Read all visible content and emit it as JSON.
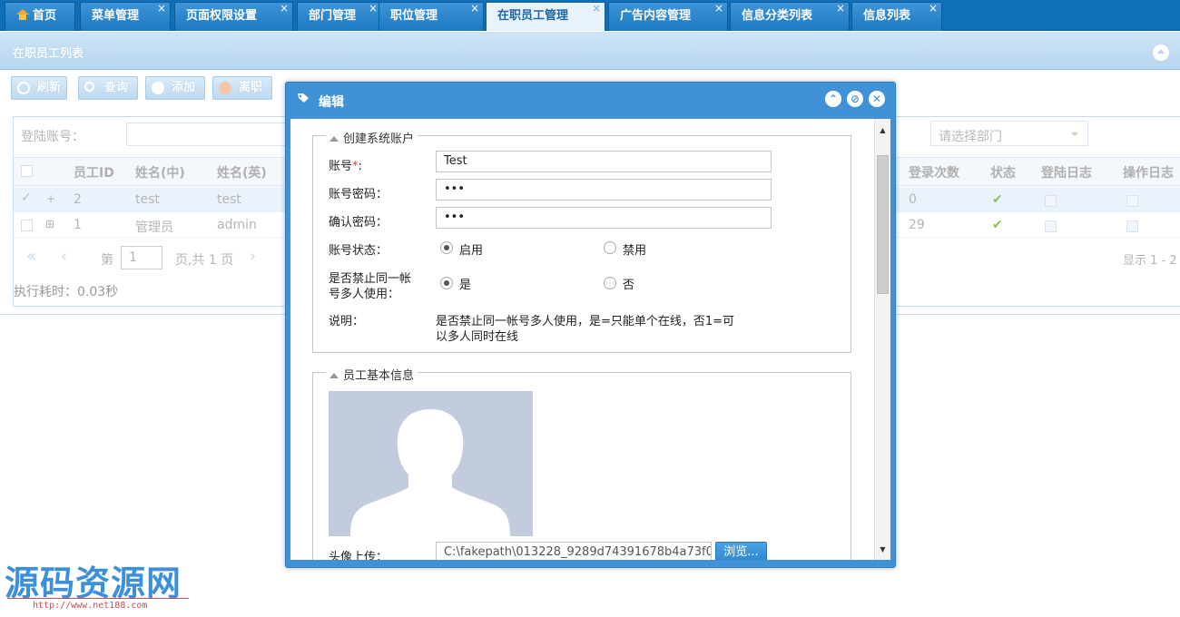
{
  "tabs": [
    {
      "label": "首页",
      "closable": false
    },
    {
      "label": "菜单管理",
      "closable": true
    },
    {
      "label": "页面权限设置",
      "closable": true
    },
    {
      "label": "部门管理",
      "closable": true
    },
    {
      "label": "职位管理",
      "closable": true
    },
    {
      "label": "在职员工管理",
      "closable": true,
      "active": true
    },
    {
      "label": "广告内容管理",
      "closable": true
    },
    {
      "label": "信息分类列表",
      "closable": true
    },
    {
      "label": "信息列表",
      "closable": true
    }
  ],
  "tab_close": "×",
  "panel": {
    "title": "在职员工列表"
  },
  "toolbar": {
    "refresh": "刷新",
    "search": "查询",
    "add": "添加",
    "resign": "离职"
  },
  "search": {
    "login_label": "登陆账号：",
    "dept_placeholder": "请选择部门"
  },
  "grid": {
    "headers": [
      "员工ID",
      "姓名(中)",
      "姓名(英)",
      "登录次数",
      "状态",
      "登陆日志",
      "操作日志"
    ],
    "rows": [
      {
        "id": "2",
        "name_cn": "test",
        "name_en": "test",
        "login_count": "0"
      },
      {
        "id": "1",
        "name_cn": "管理员",
        "name_en": "admin",
        "login_count": "29"
      }
    ],
    "pager": {
      "page_label": "第",
      "page_value": "1",
      "total_label": "页,共 1 页",
      "display": "显示 1 - 2"
    },
    "exec_time": "执行耗时：0.03秒"
  },
  "dialog": {
    "title": "编辑",
    "section1": {
      "legend": "创建系统账户",
      "account_label": "账号",
      "required_mark": "*",
      "colon": ":",
      "account_value": "Test",
      "password_label": "账号密码：",
      "password_value": "•••",
      "confirm_label": "确认密码：",
      "confirm_value": "•••",
      "status_label": "账号状态：",
      "status_enable": "启用",
      "status_disable": "禁用",
      "multi_label_1": "是否禁止同一帐",
      "multi_label_2": "号多人使用：",
      "multi_yes": "是",
      "multi_no": "否",
      "desc_label": "说明：",
      "desc_line1": "是否禁止同一帐号多人使用，是=只能单个在线，否1=可",
      "desc_line2": "以多人同时在线"
    },
    "section2": {
      "legend": "员工基本信息",
      "avatar_label": "头像上传：",
      "avatar_path": "C:\\fakepath\\013228_9289d74391678b4a73f0",
      "browse": "浏览..."
    }
  },
  "watermark": {
    "text": "源码资源网",
    "url": "http://www.net188.com"
  },
  "colors": {
    "tabbar": "#0f6fb8",
    "dialog_header": "#3f92d6",
    "panel_header": "#b7d6f0"
  }
}
